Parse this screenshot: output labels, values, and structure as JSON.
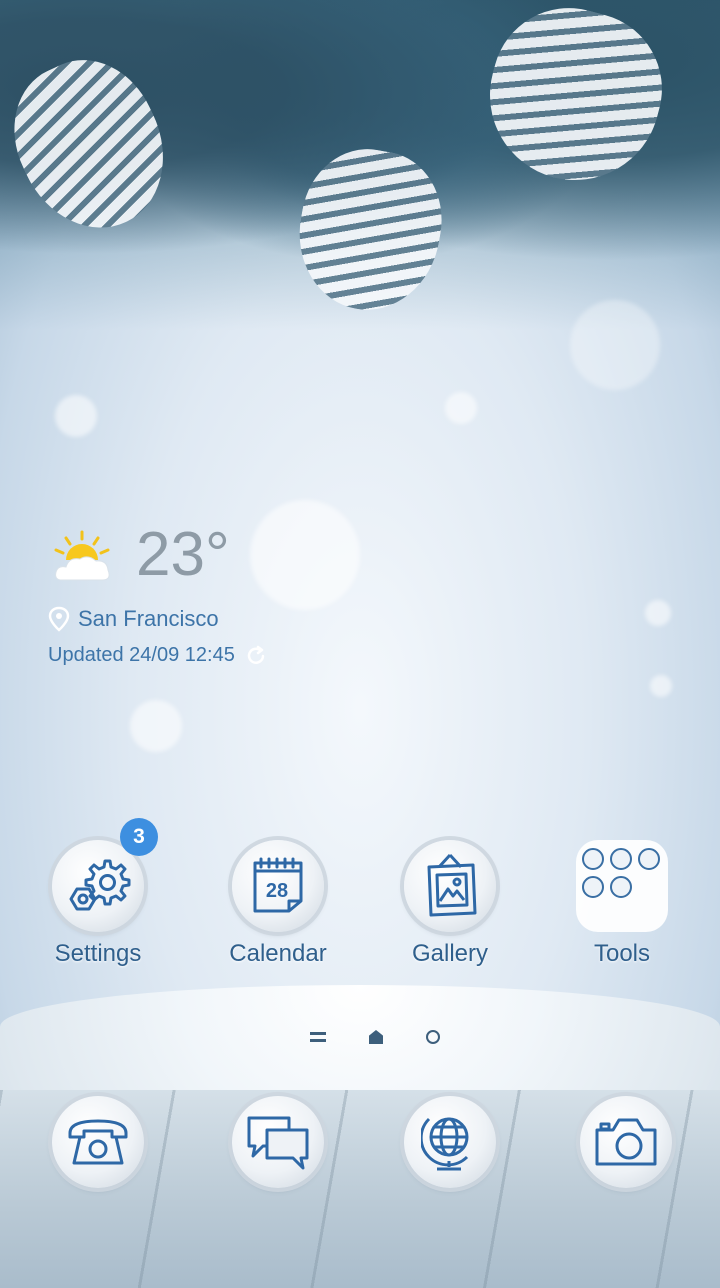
{
  "weather": {
    "temperature": "23°",
    "location": "San Francisco",
    "updated": "Updated 24/09 12:45"
  },
  "apps": [
    {
      "label": "Settings",
      "badge": "3"
    },
    {
      "label": "Calendar",
      "calendar_day": "28"
    },
    {
      "label": "Gallery"
    },
    {
      "label": "Tools"
    }
  ],
  "dock": [
    "phone",
    "messages",
    "browser",
    "camera"
  ],
  "colors": {
    "label_text": "#2f5f8c",
    "icon_stroke": "#2e68a6",
    "badge": "#3d8fe0"
  }
}
